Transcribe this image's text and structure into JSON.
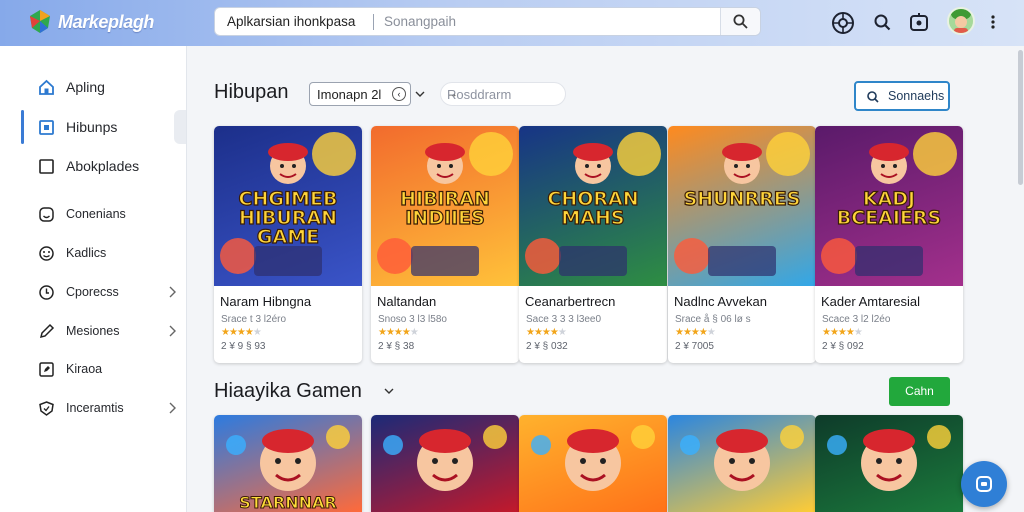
{
  "header": {
    "brand": "Markeplagh",
    "search_value": "Aplkarsian ihonkpasa",
    "search_placeholder": "Sonangpaih"
  },
  "sidebar": {
    "items": [
      {
        "label": "Apling",
        "icon": "home-icon"
      },
      {
        "label": "Hibunps",
        "icon": "square-box-icon",
        "active": true
      },
      {
        "label": "Abokplades",
        "icon": "checkbox-icon"
      },
      {
        "label": "Conenians",
        "icon": "smiley-icon"
      },
      {
        "label": "Kadlics",
        "icon": "emoji-icon"
      },
      {
        "label": "Cporecss",
        "icon": "clock-icon"
      },
      {
        "label": "Mesiones",
        "icon": "pencil-icon"
      },
      {
        "label": "Kiraoa",
        "icon": "edit-box-icon"
      },
      {
        "label": "Inceramtis",
        "icon": "shield-icon"
      }
    ]
  },
  "main": {
    "section1": {
      "title": "Hibupan",
      "filter_select": "Imonapn 2l",
      "filter_input": "Rosddrarm",
      "filter_arrow": "→",
      "button": "Sonnaehs"
    },
    "section2": {
      "title": "Hiaayika Gamen",
      "button": "Cahn"
    },
    "cards": [
      {
        "art_text": "CHGIMEB HIBURAN GAME",
        "title": "Naram Hibngna",
        "sub": "Srace t 3 l2éro",
        "rating": 4,
        "count": "2 ¥ 9 § 93",
        "colors": [
          "#1c2f8a",
          "#3a54c8"
        ]
      },
      {
        "art_text": "HIBIRAN INDIIES",
        "title": "Naltandan",
        "sub": "Snoso 3 l3 l58o",
        "rating": 4,
        "count": "2 ¥ § 38",
        "colors": [
          "#f26b2d",
          "#ffc23a"
        ]
      },
      {
        "art_text": "CHORAN MAHS",
        "title": "Ceanarbertrecn",
        "sub": "Sace 3 3 3 l3ee0",
        "rating": 4,
        "count": "2 ¥ § 032",
        "colors": [
          "#173486",
          "#2e8e42"
        ]
      },
      {
        "art_text": "SHUNRRES",
        "title": "Nadlnc Avvekan",
        "sub": "Srace å § 06 lø s",
        "rating": 4,
        "count": "2 ¥ 7005",
        "colors": [
          "#ff8a1e",
          "#31a7e8"
        ]
      },
      {
        "art_text": "KADJ BCEAIERS",
        "title": "Kader Amtaresial",
        "sub": "Scace 3 l2 l2éo",
        "rating": 4,
        "count": "2 ¥ § 092",
        "colors": [
          "#5a1a6a",
          "#a3308c"
        ]
      }
    ],
    "cards2": [
      {
        "art_text": "STARNNAR",
        "colors": [
          "#2c7be0",
          "#ff6a3a"
        ]
      },
      {
        "art_text": "",
        "colors": [
          "#1b2a78",
          "#c3192b"
        ]
      },
      {
        "art_text": "",
        "colors": [
          "#ffb22d",
          "#ff7219"
        ]
      },
      {
        "art_text": "",
        "colors": [
          "#2b86e0",
          "#ffcc35"
        ]
      },
      {
        "art_text": "",
        "colors": [
          "#0e3b2a",
          "#1b7a3c"
        ]
      }
    ]
  },
  "colors": {
    "accent": "#2f86c9",
    "green": "#22a83c",
    "topbar": "#86a9ea"
  }
}
